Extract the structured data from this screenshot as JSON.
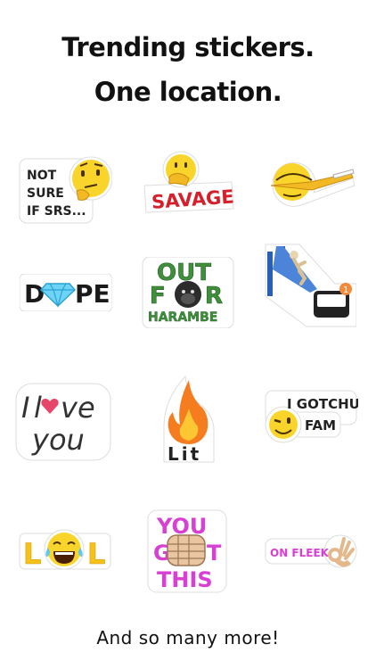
{
  "headline": {
    "line1": "Trending stickers.",
    "line2": "One location."
  },
  "footer": {
    "text": "And so many more!"
  },
  "stickers": {
    "not_sure": {
      "lines": [
        "NOT",
        "SURE",
        "IF SRS..."
      ]
    },
    "savage": {
      "text": "SAVAGE"
    },
    "dab": {
      "icon": "dab-emoji-icon"
    },
    "dope": {
      "letters": [
        "D",
        "PE"
      ],
      "icon": "diamond-icon"
    },
    "harambe": {
      "line1_a": "OUT",
      "line2_a": "F",
      "line2_b": "R",
      "line3": "HARAMBE",
      "icon": "gorilla-icon"
    },
    "slide": {
      "icon": "slide-inbox-icon",
      "badge": "1"
    },
    "love": {
      "line1_a": "I",
      "line1_b": "ve",
      "line2": "you",
      "icon": "heart-icon"
    },
    "lit": {
      "text": "Lit",
      "icon": "fire-icon"
    },
    "gotchu": {
      "line1": "I GOTCHU",
      "line2": "FAM",
      "icon": "wink-emoji-icon"
    },
    "lol": {
      "letter_l1": "L",
      "letter_l2": "L",
      "icon": "laughing-emoji-icon"
    },
    "you_got_this": {
      "line1": "YOU",
      "line2_a": "G",
      "line2_b": "T",
      "line3": "THIS",
      "icon": "fist-icon"
    },
    "on_fleek": {
      "text": "ON FLEEK",
      "icon": "ok-hand-icon"
    }
  },
  "colors": {
    "emoji_yellow": "#f9d52c",
    "savage_red": "#d3202a",
    "harambe_green": "#3f8f3b",
    "love_pink": "#e8456b",
    "you_got_this_magenta": "#d83fd3",
    "lol_yellow": "#f6c21a",
    "fire_orange": "#f57c1f"
  }
}
